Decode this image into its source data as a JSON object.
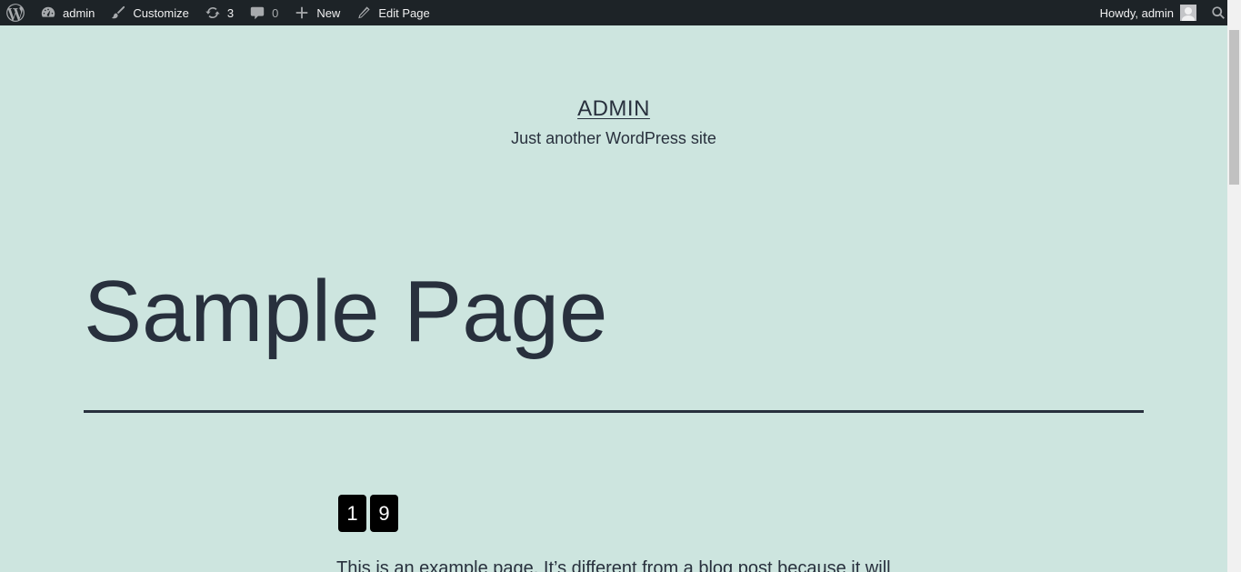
{
  "adminbar": {
    "wp_logo": "wordpress-logo-icon",
    "site_name": "admin",
    "customize": "Customize",
    "updates_count": "3",
    "comments_count": "0",
    "new_label": "New",
    "edit_label": "Edit Page",
    "howdy": "Howdy, admin"
  },
  "header": {
    "site_title": "ADMIN",
    "site_description": "Just another WordPress site"
  },
  "page": {
    "title": "Sample Page",
    "counter_digits": [
      "1",
      "9"
    ],
    "intro": "This is an example page. It’s different from a blog post because it will"
  },
  "colors": {
    "adminbar_bg": "#1d2327",
    "page_bg": "#cde5df",
    "text": "#28303d"
  }
}
